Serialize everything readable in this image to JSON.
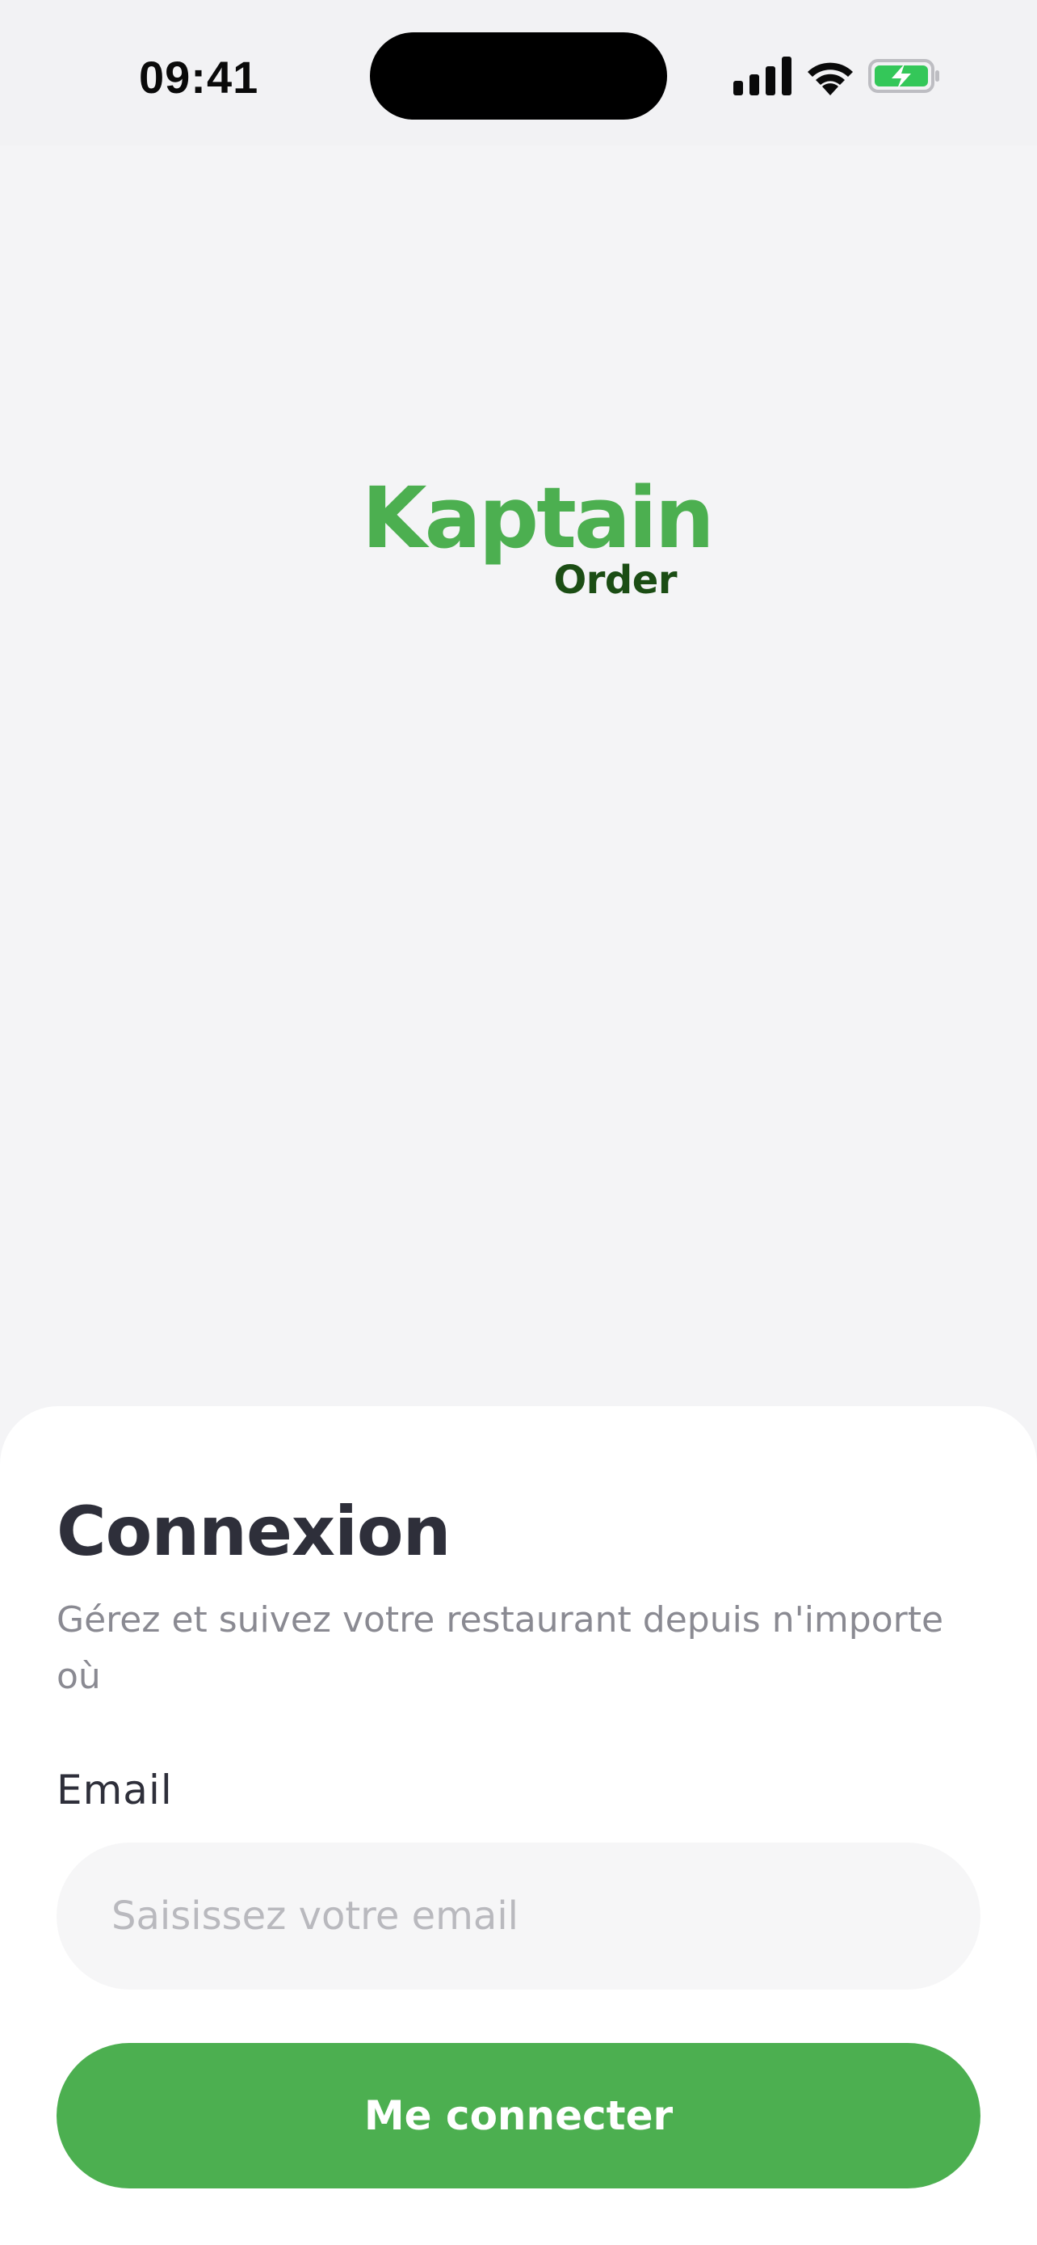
{
  "status_bar": {
    "time": "09:41",
    "icons": [
      "cellular-signal-icon",
      "wifi-icon",
      "battery-charging-icon"
    ],
    "battery_color": "#34c759"
  },
  "logo": {
    "main": "Kaptain",
    "sub": "Order",
    "main_color": "#4caf50",
    "sub_color": "#1b4d14"
  },
  "login": {
    "title": "Connexion",
    "subtitle": "Gérez et suivez votre restaurant depuis n'importe où",
    "email_label": "Email",
    "email_value": "",
    "email_placeholder": "Saisissez votre email",
    "submit_label": "Me connecter",
    "accent_color": "#4caf50"
  }
}
